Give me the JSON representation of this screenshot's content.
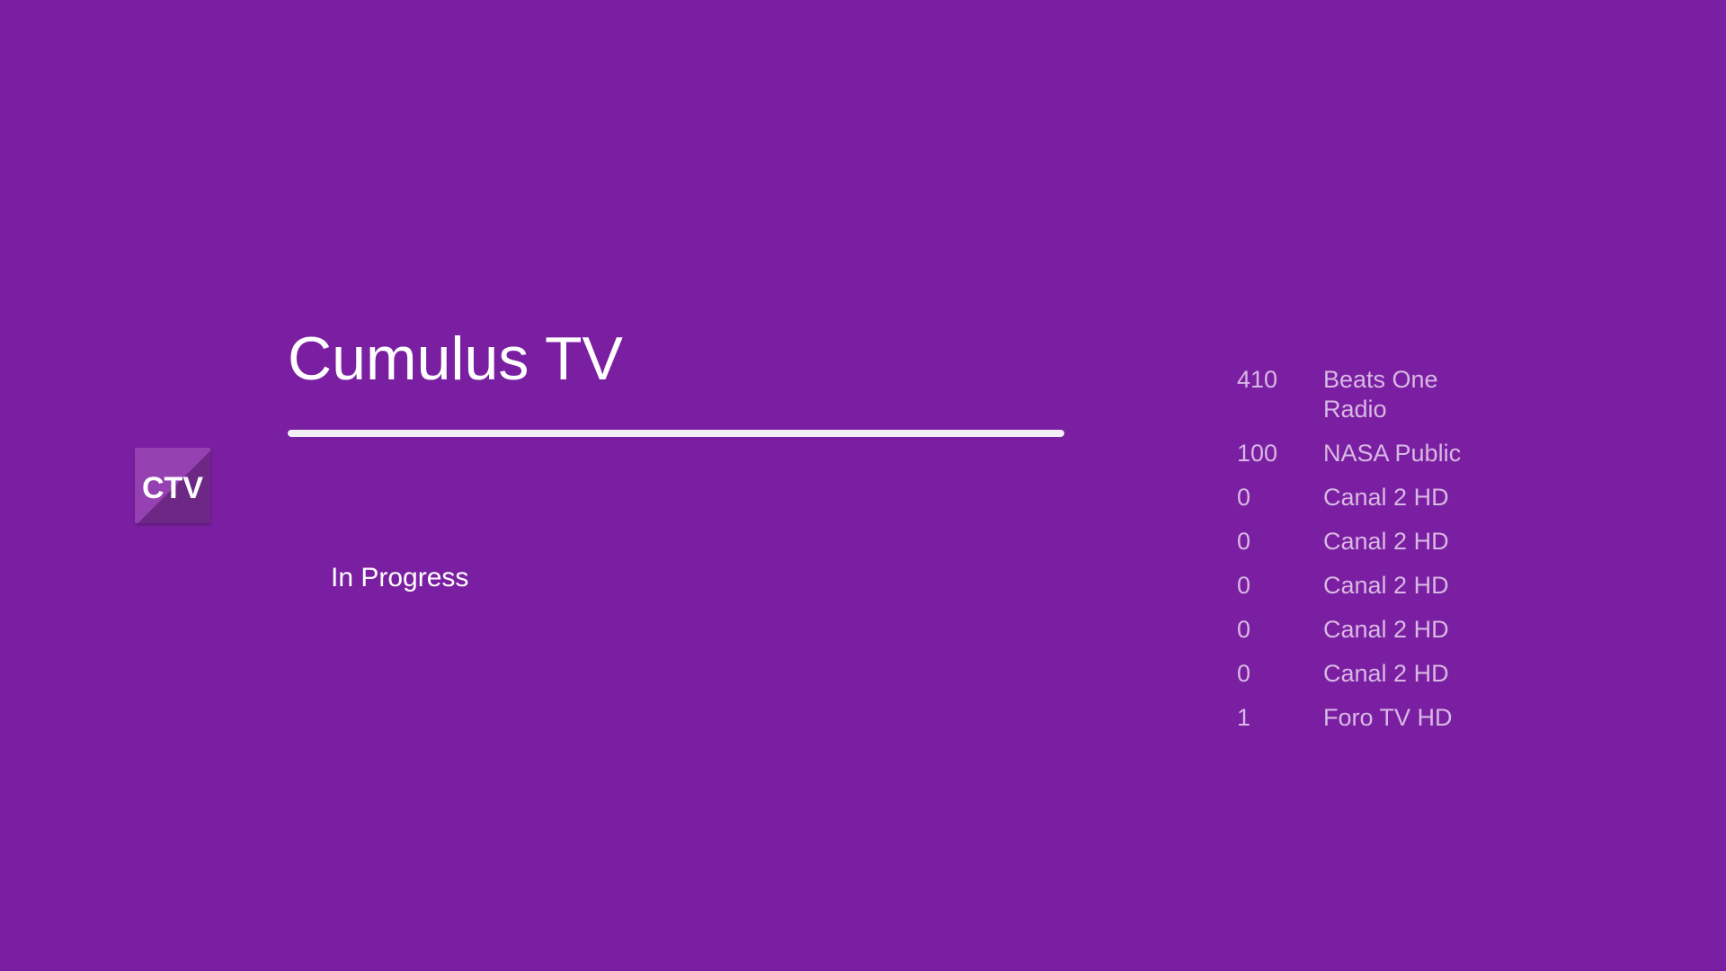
{
  "app": {
    "icon_text": "CTV",
    "title": "Cumulus TV",
    "status": "In Progress",
    "progress": 1.0
  },
  "channels": [
    {
      "number": "410",
      "name": "Beats One Radio"
    },
    {
      "number": "100",
      "name": "NASA Public"
    },
    {
      "number": "0",
      "name": "Canal 2 HD"
    },
    {
      "number": "0",
      "name": "Canal 2 HD"
    },
    {
      "number": "0",
      "name": "Canal 2 HD"
    },
    {
      "number": "0",
      "name": "Canal 2 HD"
    },
    {
      "number": "0",
      "name": "Canal 2 HD"
    },
    {
      "number": "1",
      "name": "Foro TV HD"
    }
  ],
  "colors": {
    "background": "#7b1fa2",
    "icon_background": "#9541b2",
    "channel_text": "#d7b8e3",
    "progress_fill": "#f4eef6"
  }
}
